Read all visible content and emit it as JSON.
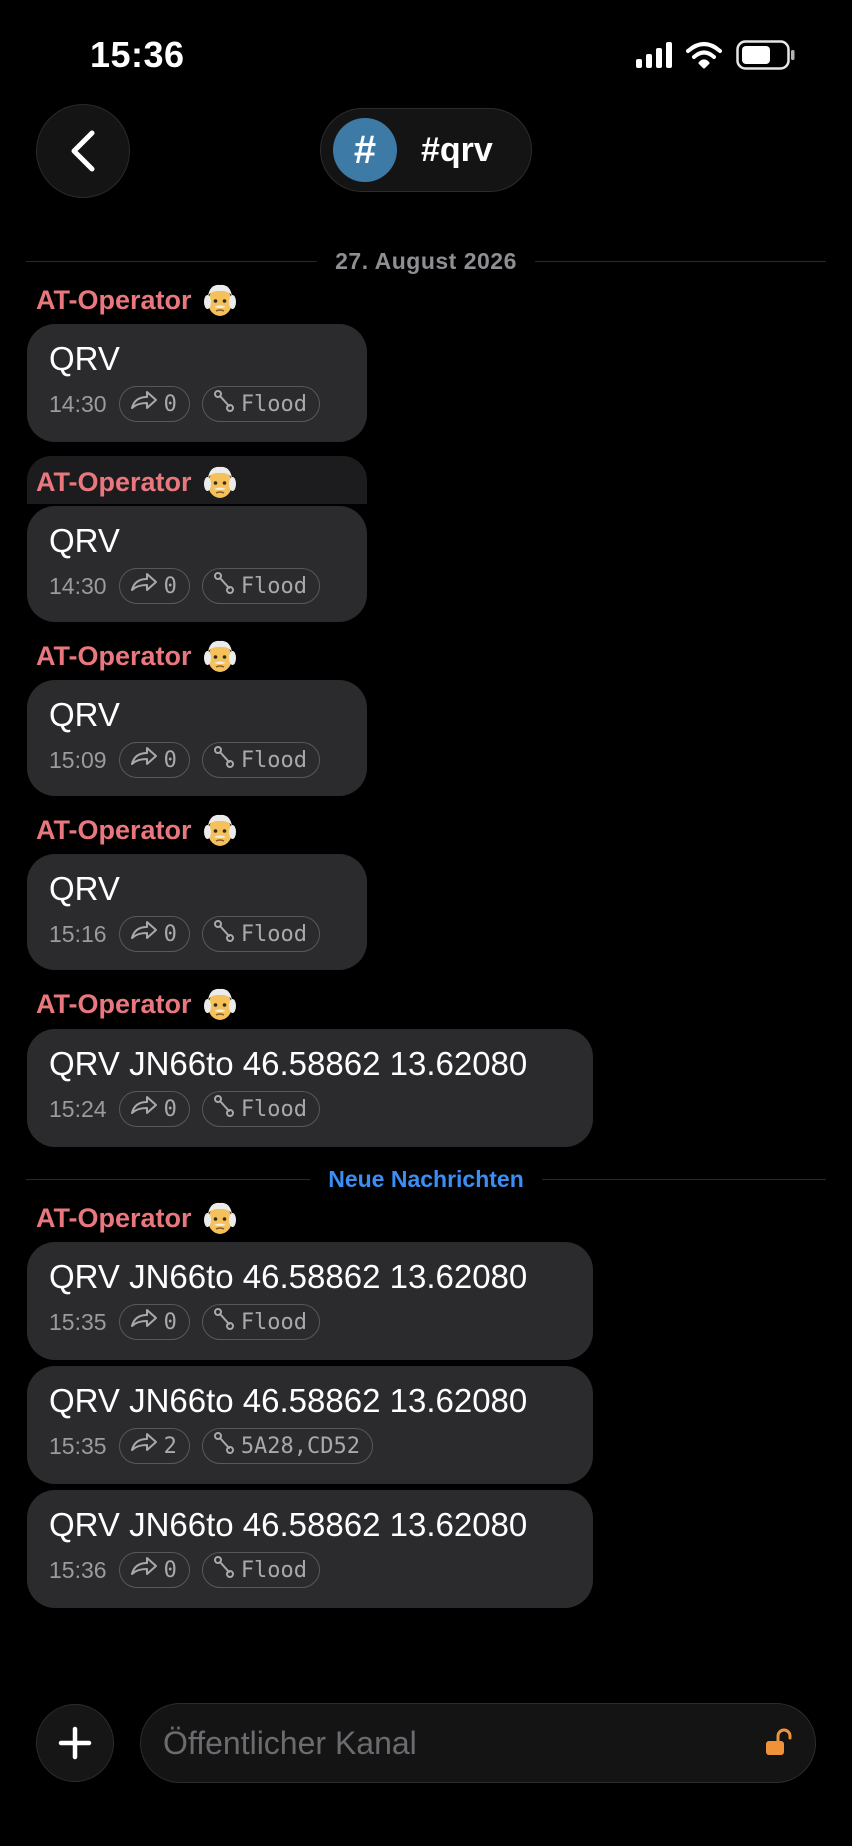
{
  "status_bar": {
    "time": "15:36"
  },
  "header": {
    "channel_avatar": "#",
    "channel_name": "#qrv"
  },
  "date_separator": "27. August 2026",
  "new_messages_separator": "Neue Nachrichten",
  "sender_emoji": "older-man-emoji",
  "messages": [
    {
      "sender": "AT-Operator",
      "text": "QRV",
      "time": "14:30",
      "hops": "0",
      "route": "Flood"
    },
    {
      "sender": "AT-Operator",
      "text": "QRV",
      "time": "14:30",
      "hops": "0",
      "route": "Flood"
    },
    {
      "sender": "AT-Operator",
      "text": "QRV",
      "time": "15:09",
      "hops": "0",
      "route": "Flood"
    },
    {
      "sender": "AT-Operator",
      "text": "QRV",
      "time": "15:16",
      "hops": "0",
      "route": "Flood"
    },
    {
      "sender": "AT-Operator",
      "text": "QRV JN66to 46.58862 13.62080",
      "time": "15:24",
      "hops": "0",
      "route": "Flood"
    },
    {
      "sender": "AT-Operator",
      "text": "QRV JN66to 46.58862 13.62080",
      "time": "15:35",
      "hops": "0",
      "route": "Flood"
    },
    {
      "text": "QRV JN66to 46.58862 13.62080",
      "time": "15:35",
      "hops": "2",
      "route": "5A28,CD52"
    },
    {
      "text": "QRV JN66to 46.58862 13.62080",
      "time": "15:36",
      "hops": "0",
      "route": "Flood"
    }
  ],
  "composer": {
    "placeholder": "Öffentlicher Kanal"
  },
  "colors": {
    "sender": "#e8777e",
    "new_separator": "#3a8ef6",
    "bubble": "#2b2b2d",
    "lock": "#f0923a",
    "channel_avatar": "#3d7aa5"
  }
}
